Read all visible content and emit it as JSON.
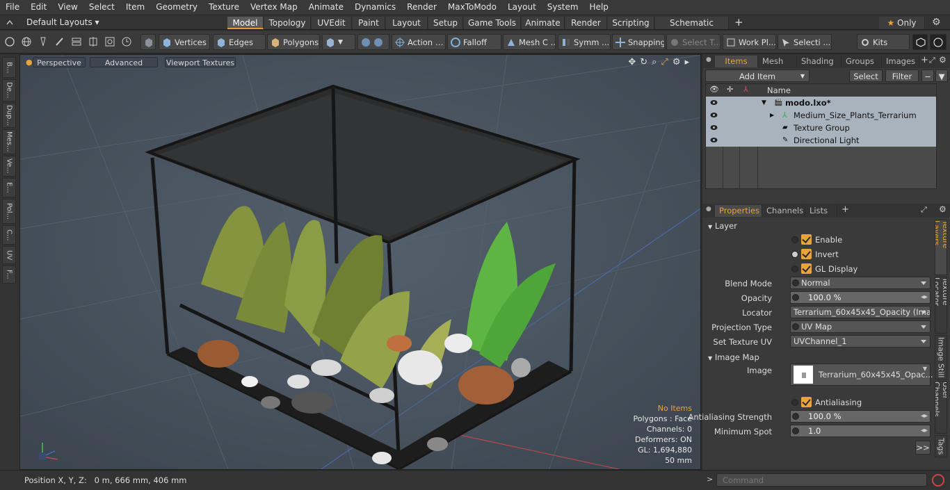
{
  "menu": [
    "File",
    "Edit",
    "View",
    "Select",
    "Item",
    "Geometry",
    "Texture",
    "Vertex Map",
    "Animate",
    "Dynamics",
    "Render",
    "MaxToModo",
    "Layout",
    "System",
    "Help"
  ],
  "layout_selector": "Default Layouts",
  "layout_tabs": [
    "Model",
    "Topology",
    "UVEdit",
    "Paint",
    "Layout",
    "Setup",
    "Game Tools",
    "Animate",
    "Render",
    "Scripting",
    "Schematic Fusion"
  ],
  "active_layout_tab": "Model",
  "only_label": "Only",
  "toolbar": {
    "vertices": "Vertices",
    "edges": "Edges",
    "polygons": "Polygons",
    "action": "Action",
    "falloff": "Falloff",
    "mesh": "Mesh C ...",
    "symmetry": "Symm ...",
    "snapping": "Snapping",
    "select_t": "Select T...",
    "workplane": "Work Pl...",
    "selection": "Selecti ...",
    "kits": "Kits"
  },
  "left_tabs": [
    "B...",
    "De...",
    "Dup...",
    "Mes...",
    "Ve...",
    "E...",
    "Pol...",
    "C...",
    "UV",
    "F..."
  ],
  "viewport": {
    "mode": "Perspective",
    "advanced": "Advanced",
    "textures": "Viewport Textures",
    "stats": {
      "items": "No Items",
      "polygons": "Polygons : Face",
      "channels": "Channels: 0",
      "deformers": "Deformers: ON",
      "gl": "GL: 1,694,880",
      "size": "50 mm"
    }
  },
  "status": {
    "position": "Position X, Y, Z:   0 m, 666 mm, 406 mm"
  },
  "items_panel": {
    "tabs": [
      "Items",
      "Mesh ...",
      "Shading",
      "Groups",
      "Images"
    ],
    "add_item": "Add Item",
    "select": "Select",
    "filter": "Filter",
    "name_header": "Name",
    "rows": [
      {
        "label": "modo.lxo*"
      },
      {
        "label": "Medium_Size_Plants_Terrarium"
      },
      {
        "label": "Texture Group"
      },
      {
        "label": "Directional Light"
      }
    ]
  },
  "properties": {
    "tabs": [
      "Properties",
      "Channels",
      "Lists"
    ],
    "layer_header": "Layer",
    "enable": "Enable",
    "invert": "Invert",
    "gl_display": "GL Display",
    "blend_mode_label": "Blend Mode",
    "blend_mode": "Normal",
    "opacity_label": "Opacity",
    "opacity": "100.0 %",
    "locator_label": "Locator",
    "locator": "Terrarium_60x45x45_Opacity (Ima ...",
    "projection_label": "Projection Type",
    "projection": "UV Map",
    "set_uv_label": "Set Texture UV",
    "set_uv": "UVChannel_1",
    "image_map_header": "Image Map",
    "image_label": "Image",
    "image": "Terrarium_60x45x45_Opac...",
    "antialiasing": "Antialiasing",
    "aa_strength_label": "Antialiasing Strength",
    "aa_strength": "100.0 %",
    "min_spot_label": "Minimum Spot",
    "min_spot": "1.0",
    "more": ">>"
  },
  "right_tabs": [
    "Texture Layers",
    "Texture Locator",
    "Image Still",
    "User Channels",
    "Tags"
  ],
  "command_placeholder": "Command",
  "colors": {
    "accent": "#e9a33b",
    "viewport_bg": "#485360"
  }
}
